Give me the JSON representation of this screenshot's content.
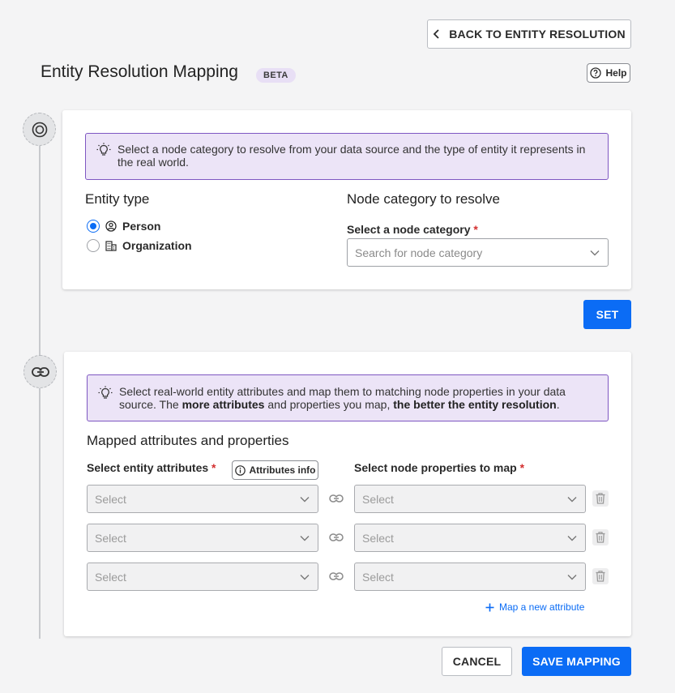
{
  "header": {
    "back_label": "BACK TO ENTITY RESOLUTION",
    "title": "Entity Resolution Mapping",
    "badge": "BETA",
    "help_label": "Help"
  },
  "step1": {
    "tip": "Select a node category to resolve from your data source and the type of entity it represents in the real world.",
    "entity_type_heading": "Entity type",
    "options": [
      {
        "label": "Person",
        "icon": "person-circle-icon",
        "selected": true
      },
      {
        "label": "Organization",
        "icon": "building-icon",
        "selected": false
      }
    ],
    "node_heading": "Node category to resolve",
    "node_label": "Select a node category",
    "node_required": "*",
    "node_placeholder": "Search for node category",
    "set_label": "SET"
  },
  "step2": {
    "tip_parts": {
      "p1": "Select real-world entity attributes and map them to matching node properties in your data source. The ",
      "b1": "more attributes",
      "p2": " and properties you map, ",
      "b2": "the better the entity resolution",
      "p3": "."
    },
    "heading": "Mapped attributes and properties",
    "attr_label": "Select entity attributes",
    "attr_required": "*",
    "attr_info_label": "Attributes info",
    "prop_label": "Select node properties to map",
    "prop_required": "*",
    "rows": [
      {
        "attr": "Select",
        "prop": "Select"
      },
      {
        "attr": "Select",
        "prop": "Select"
      },
      {
        "attr": "Select",
        "prop": "Select"
      }
    ],
    "add_label": "Map a new attribute"
  },
  "footer": {
    "cancel_label": "CANCEL",
    "save_label": "SAVE MAPPING"
  },
  "colors": {
    "primary": "#0b6cf5",
    "tip_bg": "#ece4f7",
    "tip_border": "#7e57c2",
    "required": "#d32f2f"
  }
}
